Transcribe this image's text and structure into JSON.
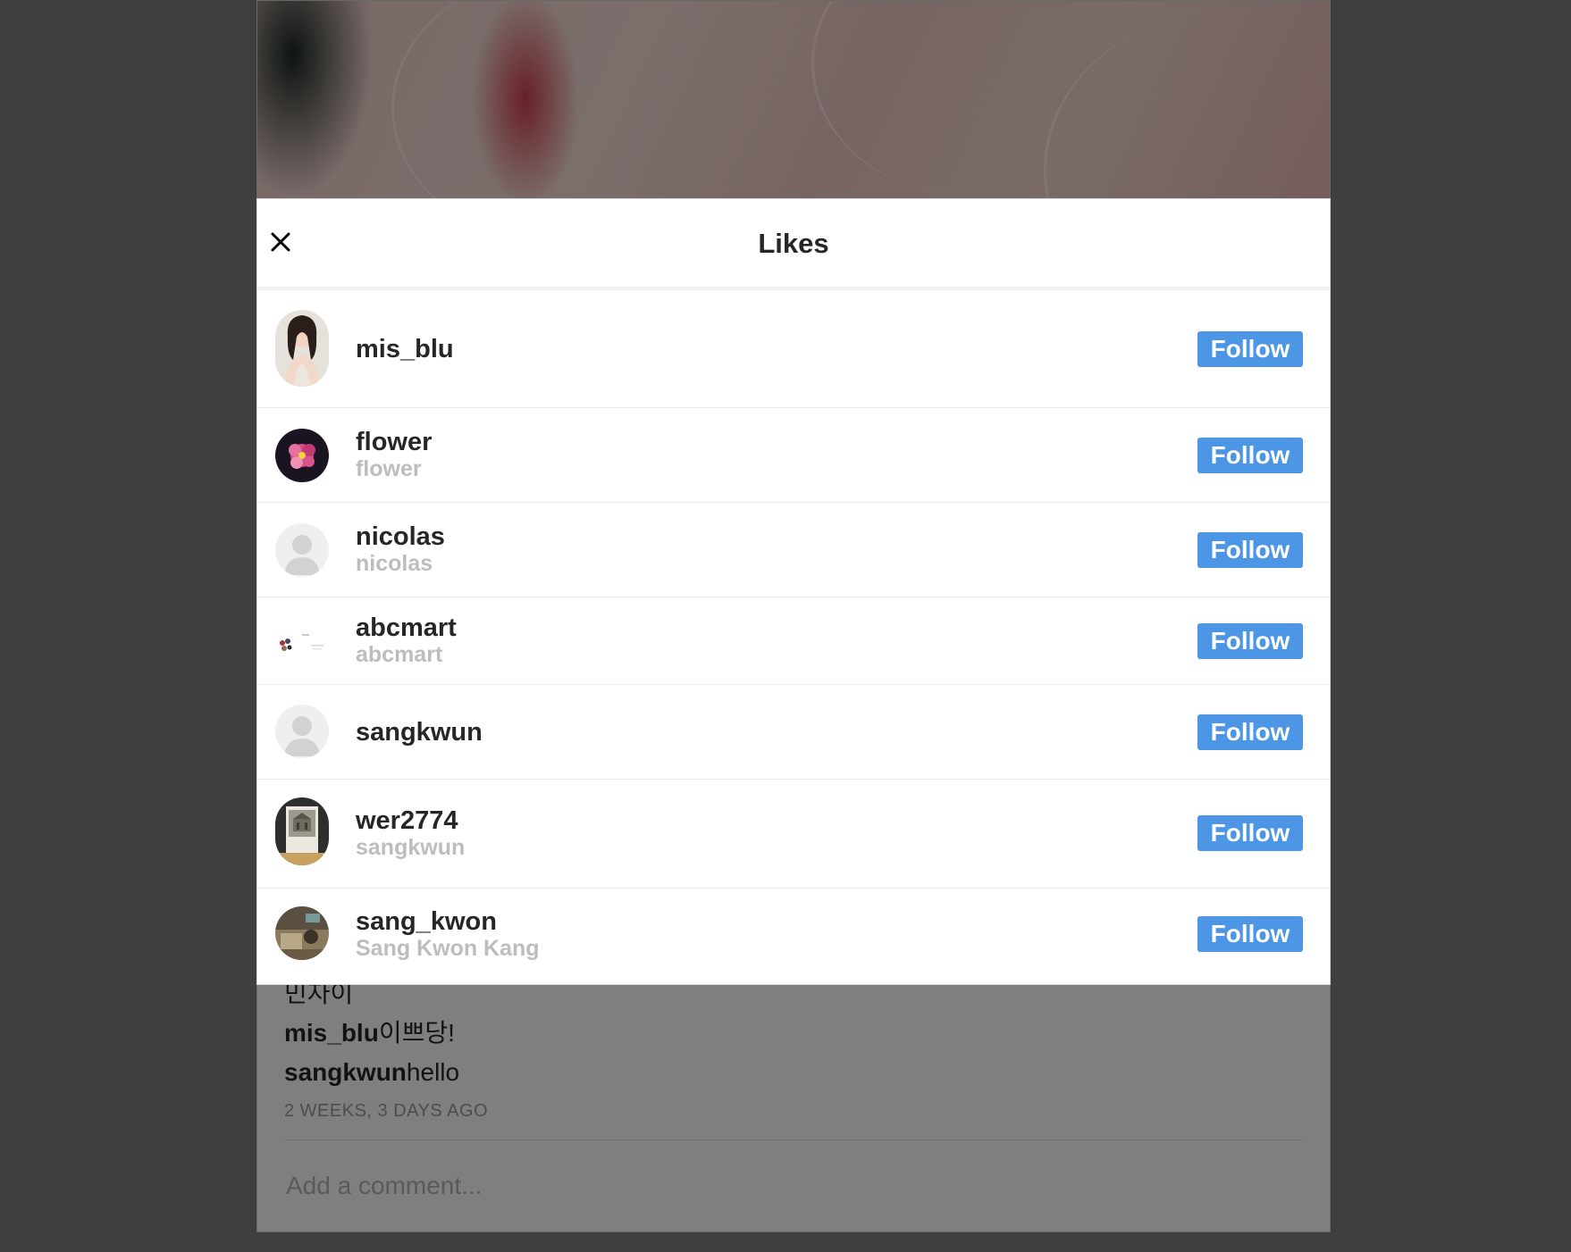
{
  "modal": {
    "title": "Likes",
    "follow_label": "Follow",
    "users": [
      {
        "username": "mis_blu",
        "fullname": "",
        "avatar": "photo-woman"
      },
      {
        "username": "flower",
        "fullname": "flower",
        "avatar": "photo-flower"
      },
      {
        "username": "nicolas",
        "fullname": "nicolas",
        "avatar": "default-silhouette"
      },
      {
        "username": "abcmart",
        "fullname": "abcmart",
        "avatar": "photo-products"
      },
      {
        "username": "sangkwun",
        "fullname": "",
        "avatar": "default-silhouette"
      },
      {
        "username": "wer2774",
        "fullname": "sangkwun",
        "avatar": "photo-building"
      },
      {
        "username": "sang_kwon",
        "fullname": "Sang Kwon Kang",
        "avatar": "photo-room"
      }
    ]
  },
  "post": {
    "comments": [
      {
        "user": "",
        "text": "민자이"
      },
      {
        "user": "mis_blu",
        "text": "이쁘당!"
      },
      {
        "user": "sangkwun",
        "text": "hello"
      }
    ],
    "time": "2 WEEKS, 3 DAYS AGO",
    "comment_placeholder": "Add a comment..."
  },
  "colors": {
    "follow_button": "#4d96e6",
    "overlay": "rgba(0,0,0,0.5)"
  }
}
